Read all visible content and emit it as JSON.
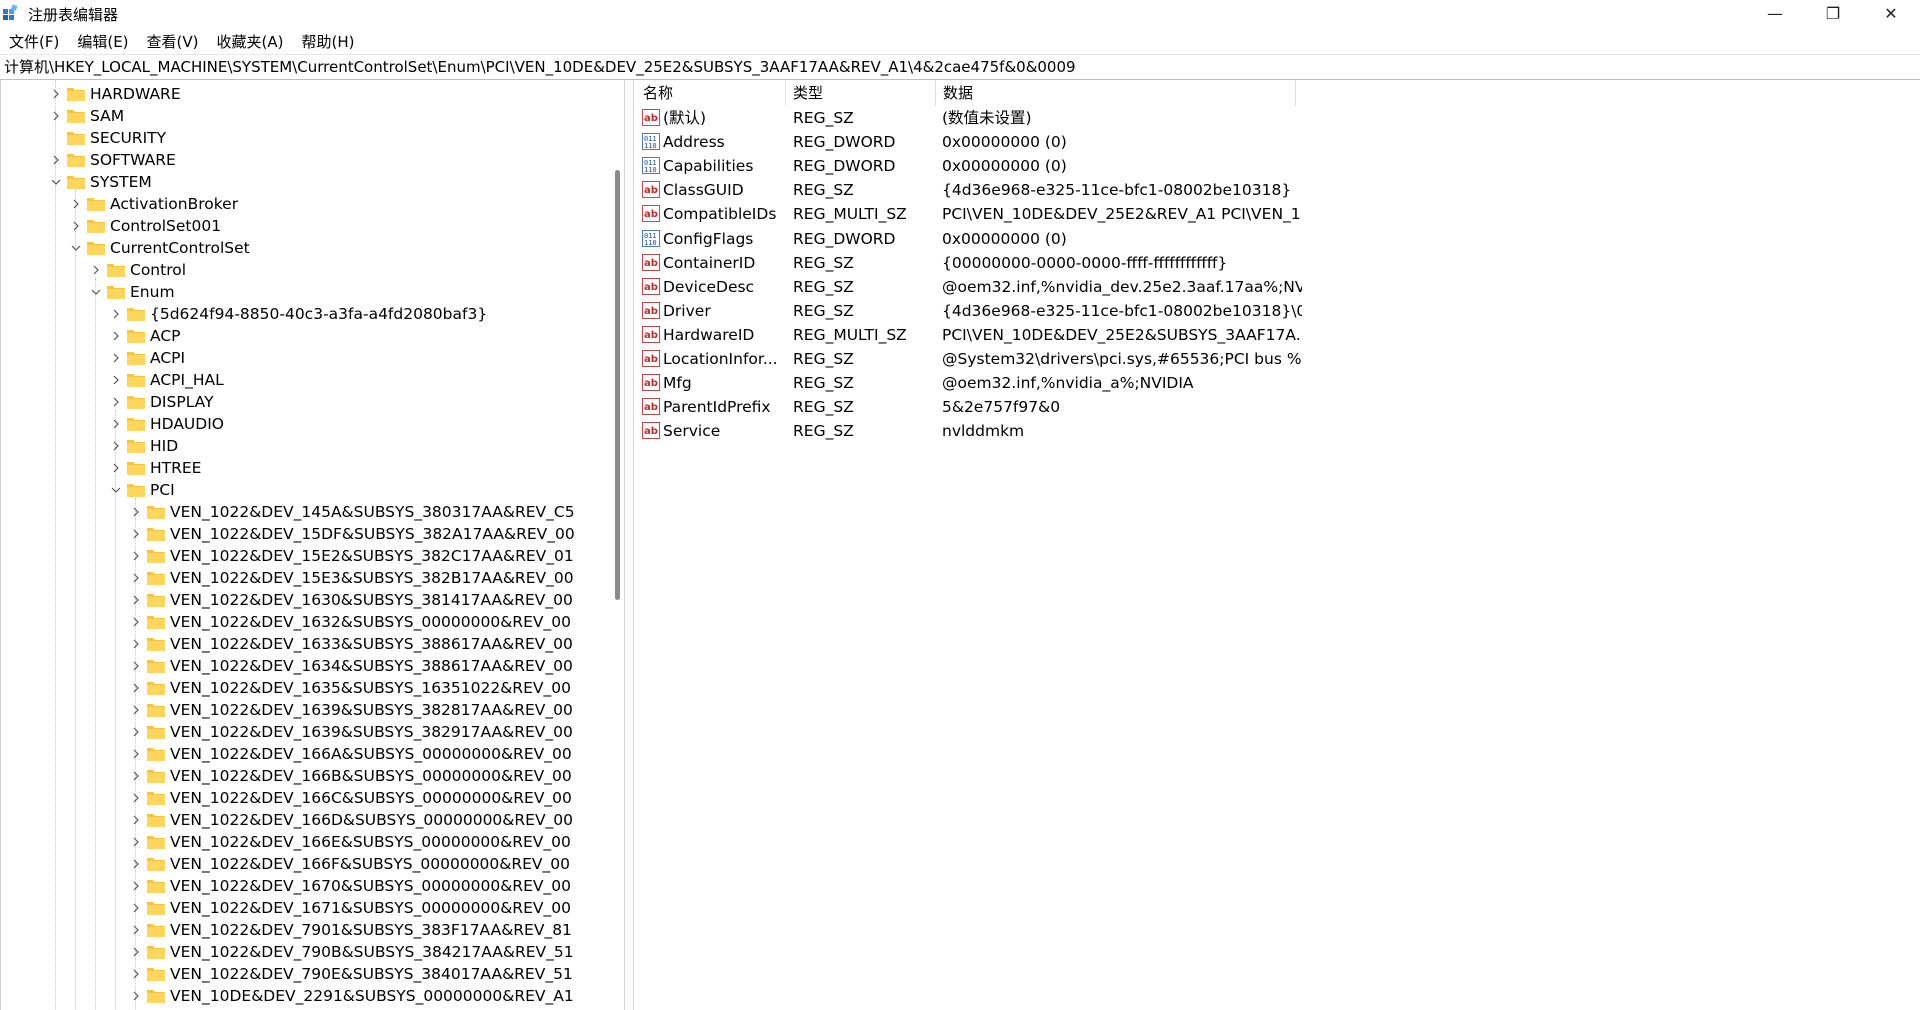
{
  "window": {
    "title": "注册表编辑器",
    "minimize": "—",
    "maximize": "❐",
    "close": "✕"
  },
  "menu": [
    "文件(F)",
    "编辑(E)",
    "查看(V)",
    "收藏夹(A)",
    "帮助(H)"
  ],
  "address": "计算机\\HKEY_LOCAL_MACHINE\\SYSTEM\\CurrentControlSet\\Enum\\PCI\\VEN_10DE&DEV_25E2&SUBSYS_3AAF17AA&REV_A1\\4&2cae475f&0&0009",
  "tree": [
    {
      "label": "HARDWARE",
      "depth": 0,
      "chev": "right"
    },
    {
      "label": "SAM",
      "depth": 0,
      "chev": "right"
    },
    {
      "label": "SECURITY",
      "depth": 0,
      "chev": "none"
    },
    {
      "label": "SOFTWARE",
      "depth": 0,
      "chev": "right"
    },
    {
      "label": "SYSTEM",
      "depth": 0,
      "chev": "down"
    },
    {
      "label": "ActivationBroker",
      "depth": 1,
      "chev": "right"
    },
    {
      "label": "ControlSet001",
      "depth": 1,
      "chev": "right"
    },
    {
      "label": "CurrentControlSet",
      "depth": 1,
      "chev": "down"
    },
    {
      "label": "Control",
      "depth": 2,
      "chev": "right"
    },
    {
      "label": "Enum",
      "depth": 2,
      "chev": "down"
    },
    {
      "label": "{5d624f94-8850-40c3-a3fa-a4fd2080baf3}",
      "depth": 3,
      "chev": "right"
    },
    {
      "label": "ACP",
      "depth": 3,
      "chev": "right"
    },
    {
      "label": "ACPI",
      "depth": 3,
      "chev": "right"
    },
    {
      "label": "ACPI_HAL",
      "depth": 3,
      "chev": "right"
    },
    {
      "label": "DISPLAY",
      "depth": 3,
      "chev": "right"
    },
    {
      "label": "HDAUDIO",
      "depth": 3,
      "chev": "right"
    },
    {
      "label": "HID",
      "depth": 3,
      "chev": "right"
    },
    {
      "label": "HTREE",
      "depth": 3,
      "chev": "right"
    },
    {
      "label": "PCI",
      "depth": 3,
      "chev": "down"
    },
    {
      "label": "VEN_1022&DEV_145A&SUBSYS_380317AA&REV_C5",
      "depth": 4,
      "chev": "right"
    },
    {
      "label": "VEN_1022&DEV_15DF&SUBSYS_382A17AA&REV_00",
      "depth": 4,
      "chev": "right"
    },
    {
      "label": "VEN_1022&DEV_15E2&SUBSYS_382C17AA&REV_01",
      "depth": 4,
      "chev": "right"
    },
    {
      "label": "VEN_1022&DEV_15E3&SUBSYS_382B17AA&REV_00",
      "depth": 4,
      "chev": "right"
    },
    {
      "label": "VEN_1022&DEV_1630&SUBSYS_381417AA&REV_00",
      "depth": 4,
      "chev": "right"
    },
    {
      "label": "VEN_1022&DEV_1632&SUBSYS_00000000&REV_00",
      "depth": 4,
      "chev": "right"
    },
    {
      "label": "VEN_1022&DEV_1633&SUBSYS_388617AA&REV_00",
      "depth": 4,
      "chev": "right"
    },
    {
      "label": "VEN_1022&DEV_1634&SUBSYS_388617AA&REV_00",
      "depth": 4,
      "chev": "right"
    },
    {
      "label": "VEN_1022&DEV_1635&SUBSYS_16351022&REV_00",
      "depth": 4,
      "chev": "right"
    },
    {
      "label": "VEN_1022&DEV_1639&SUBSYS_382817AA&REV_00",
      "depth": 4,
      "chev": "right"
    },
    {
      "label": "VEN_1022&DEV_1639&SUBSYS_382917AA&REV_00",
      "depth": 4,
      "chev": "right"
    },
    {
      "label": "VEN_1022&DEV_166A&SUBSYS_00000000&REV_00",
      "depth": 4,
      "chev": "right"
    },
    {
      "label": "VEN_1022&DEV_166B&SUBSYS_00000000&REV_00",
      "depth": 4,
      "chev": "right"
    },
    {
      "label": "VEN_1022&DEV_166C&SUBSYS_00000000&REV_00",
      "depth": 4,
      "chev": "right"
    },
    {
      "label": "VEN_1022&DEV_166D&SUBSYS_00000000&REV_00",
      "depth": 4,
      "chev": "right"
    },
    {
      "label": "VEN_1022&DEV_166E&SUBSYS_00000000&REV_00",
      "depth": 4,
      "chev": "right"
    },
    {
      "label": "VEN_1022&DEV_166F&SUBSYS_00000000&REV_00",
      "depth": 4,
      "chev": "right"
    },
    {
      "label": "VEN_1022&DEV_1670&SUBSYS_00000000&REV_00",
      "depth": 4,
      "chev": "right"
    },
    {
      "label": "VEN_1022&DEV_1671&SUBSYS_00000000&REV_00",
      "depth": 4,
      "chev": "right"
    },
    {
      "label": "VEN_1022&DEV_7901&SUBSYS_383F17AA&REV_81",
      "depth": 4,
      "chev": "right"
    },
    {
      "label": "VEN_1022&DEV_790B&SUBSYS_384217AA&REV_51",
      "depth": 4,
      "chev": "right"
    },
    {
      "label": "VEN_1022&DEV_790E&SUBSYS_384017AA&REV_51",
      "depth": 4,
      "chev": "right"
    },
    {
      "label": "VEN_10DE&DEV_2291&SUBSYS_00000000&REV_A1",
      "depth": 4,
      "chev": "right"
    }
  ],
  "columns": [
    "名称",
    "类型",
    "数据"
  ],
  "values": [
    {
      "name": "(默认)",
      "type": "REG_SZ",
      "data": "(数值未设置)",
      "icon": "string-value-icon"
    },
    {
      "name": "Address",
      "type": "REG_DWORD",
      "data": "0x00000000 (0)",
      "icon": "binary-value-icon"
    },
    {
      "name": "Capabilities",
      "type": "REG_DWORD",
      "data": "0x00000000 (0)",
      "icon": "binary-value-icon"
    },
    {
      "name": "ClassGUID",
      "type": "REG_SZ",
      "data": "{4d36e968-e325-11ce-bfc1-08002be10318}",
      "icon": "string-value-icon"
    },
    {
      "name": "CompatibleIDs",
      "type": "REG_MULTI_SZ",
      "data": "PCI\\VEN_10DE&DEV_25E2&REV_A1 PCI\\VEN_1...",
      "icon": "string-value-icon"
    },
    {
      "name": "ConfigFlags",
      "type": "REG_DWORD",
      "data": "0x00000000 (0)",
      "icon": "binary-value-icon"
    },
    {
      "name": "ContainerID",
      "type": "REG_SZ",
      "data": "{00000000-0000-0000-ffff-ffffffffffff}",
      "icon": "string-value-icon"
    },
    {
      "name": "DeviceDesc",
      "type": "REG_SZ",
      "data": "@oem32.inf,%nvidia_dev.25e2.3aaf.17aa%;NV...",
      "icon": "string-value-icon"
    },
    {
      "name": "Driver",
      "type": "REG_SZ",
      "data": "{4d36e968-e325-11ce-bfc1-08002be10318}\\0...",
      "icon": "string-value-icon"
    },
    {
      "name": "HardwareID",
      "type": "REG_MULTI_SZ",
      "data": "PCI\\VEN_10DE&DEV_25E2&SUBSYS_3AAF17A...",
      "icon": "string-value-icon"
    },
    {
      "name": "LocationInfor...",
      "type": "REG_SZ",
      "data": "@System32\\drivers\\pci.sys,#65536;PCI bus %...",
      "icon": "string-value-icon"
    },
    {
      "name": "Mfg",
      "type": "REG_SZ",
      "data": "@oem32.inf,%nvidia_a%;NVIDIA",
      "icon": "string-value-icon"
    },
    {
      "name": "ParentIdPrefix",
      "type": "REG_SZ",
      "data": "5&2e757f97&0",
      "icon": "string-value-icon"
    },
    {
      "name": "Service",
      "type": "REG_SZ",
      "data": "nvlddmkm",
      "icon": "string-value-icon"
    }
  ]
}
